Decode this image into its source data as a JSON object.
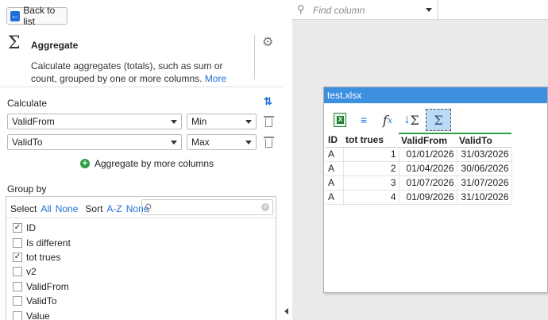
{
  "back_button": {
    "label": "Back to list"
  },
  "header": {
    "title": "Aggregate",
    "description": "Calculate aggregates (totals), such as sum or count, grouped by one or more columns.",
    "more_link": "More"
  },
  "calculate": {
    "label": "Calculate",
    "rows": [
      {
        "column": "ValidFrom",
        "function": "Min"
      },
      {
        "column": "ValidTo",
        "function": "Max"
      }
    ],
    "add_label": "Aggregate by more columns"
  },
  "group_by": {
    "label": "Group by",
    "select_label": "Select",
    "all_label": "All",
    "none_label": "None",
    "sort_label": "Sort",
    "az_label": "A-Z",
    "sort_none_label": "None",
    "items": [
      {
        "label": "ID",
        "checked": true
      },
      {
        "label": "Is different",
        "checked": false
      },
      {
        "label": "tot trues",
        "checked": true
      },
      {
        "label": "v2",
        "checked": false
      },
      {
        "label": "ValidFrom",
        "checked": false
      },
      {
        "label": "ValidTo",
        "checked": false
      },
      {
        "label": "Value",
        "checked": false
      }
    ]
  },
  "find_column": {
    "placeholder": "Find column"
  },
  "node": {
    "title": "test.xlsx",
    "columns": [
      "ID",
      "tot trues",
      "ValidFrom",
      "ValidTo"
    ],
    "rows": [
      [
        "A",
        "1",
        "01/01/2026",
        "31/03/2026"
      ],
      [
        "A",
        "2",
        "01/04/2026",
        "30/06/2026"
      ],
      [
        "A",
        "3",
        "01/07/2026",
        "31/07/2026"
      ],
      [
        "A",
        "4",
        "01/09/2026",
        "31/10/2026"
      ]
    ]
  }
}
